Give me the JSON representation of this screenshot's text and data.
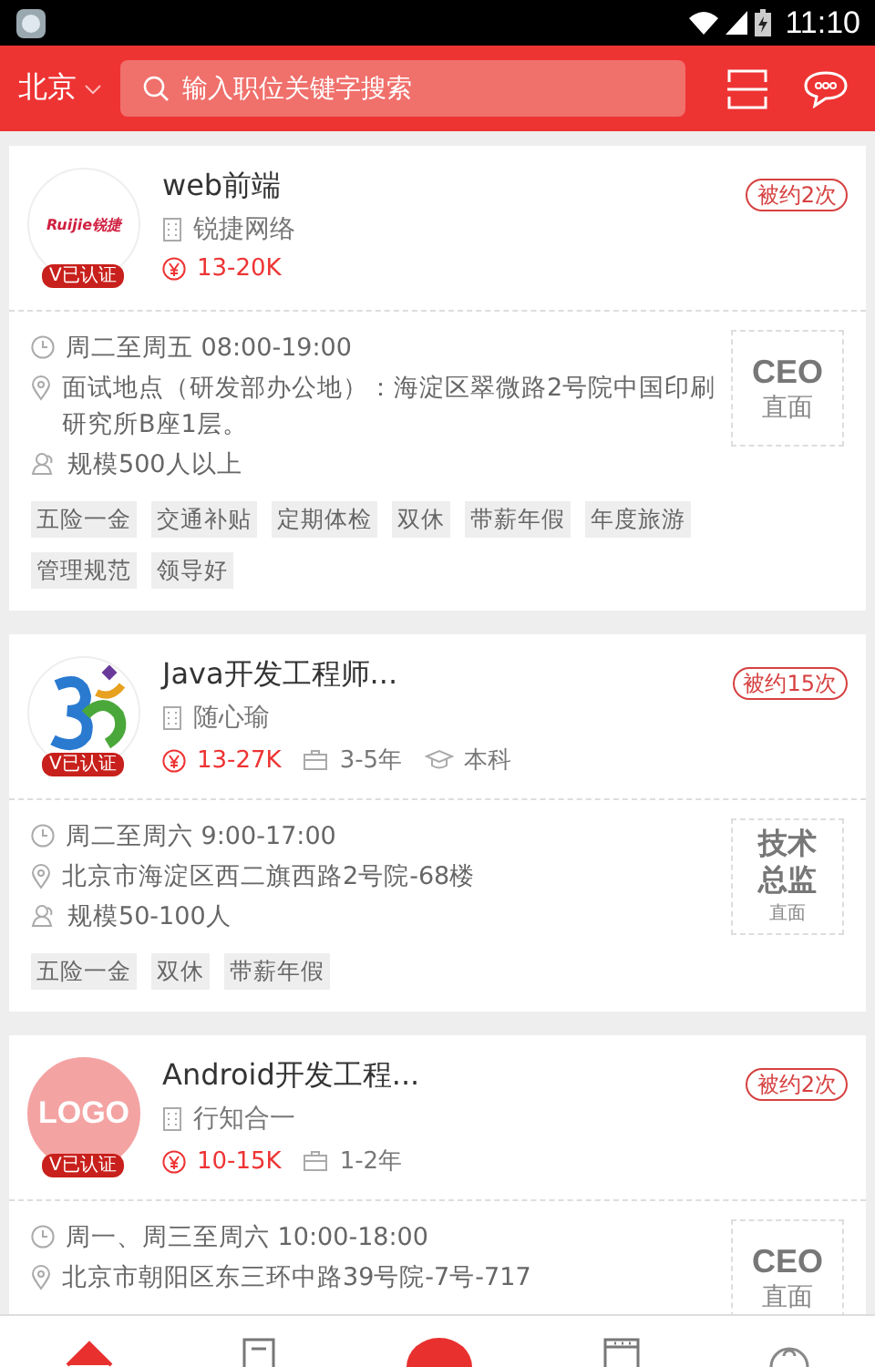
{
  "status_bar": {
    "time": "11:10"
  },
  "header": {
    "city": "北京",
    "search": {
      "placeholder": "输入职位关键字搜索"
    }
  },
  "jobs": [
    {
      "logo": {
        "kind": "ruijie"
      },
      "logo_text": "Ruijie锐捷",
      "verified_badge": "V已认证",
      "title": "web前端",
      "company": "锐捷网络",
      "salary": "13-20K",
      "invites": "被约2次",
      "schedule": "周二至周五 08:00-19:00",
      "location": "面试地点（研发部办公地）：海淀区翠微路2号院中国印刷研究所B座1层。",
      "scale": "规模500人以上",
      "interviewer": {
        "title": "CEO",
        "label": "直面"
      },
      "tags": [
        "五险一金",
        "交通补贴",
        "定期体检",
        "双休",
        "带薪年假",
        "年度旅游",
        "管理规范",
        "领导好"
      ]
    },
    {
      "logo": {
        "kind": "swirl"
      },
      "verified_badge": "V已认证",
      "title": "Java开发工程师...",
      "company": "随心瑜",
      "salary": "13-27K",
      "experience": "3-5年",
      "education": "本科",
      "invites": "被约15次",
      "schedule": "周二至周六 9:00-17:00",
      "location": "北京市海淀区西二旗西路2号院-68楼",
      "scale": "规模50-100人",
      "interviewer": {
        "title": "技术总监",
        "label": "直面"
      },
      "tags": [
        "五险一金",
        "双休",
        "带薪年假"
      ]
    },
    {
      "logo": {
        "kind": "placeholder"
      },
      "logo_text": "LOGO",
      "verified_badge": "V已认证",
      "title": "Android开发工程...",
      "company": "行知合一",
      "salary": "10-15K",
      "experience": "1-2年",
      "invites": "被约2次",
      "schedule": "周一、周三至周六 10:00-18:00",
      "location": "北京市朝阳区东三环中路39号院-7号-717",
      "interviewer": {
        "title": "CEO",
        "label": "直面"
      }
    }
  ],
  "tab_bar": [
    {
      "kind": "home",
      "selected": true
    },
    {
      "kind": "document",
      "selected": false
    },
    {
      "kind": "center",
      "selected": false
    },
    {
      "kind": "calendar",
      "selected": false
    },
    {
      "kind": "profile",
      "selected": false
    }
  ]
}
